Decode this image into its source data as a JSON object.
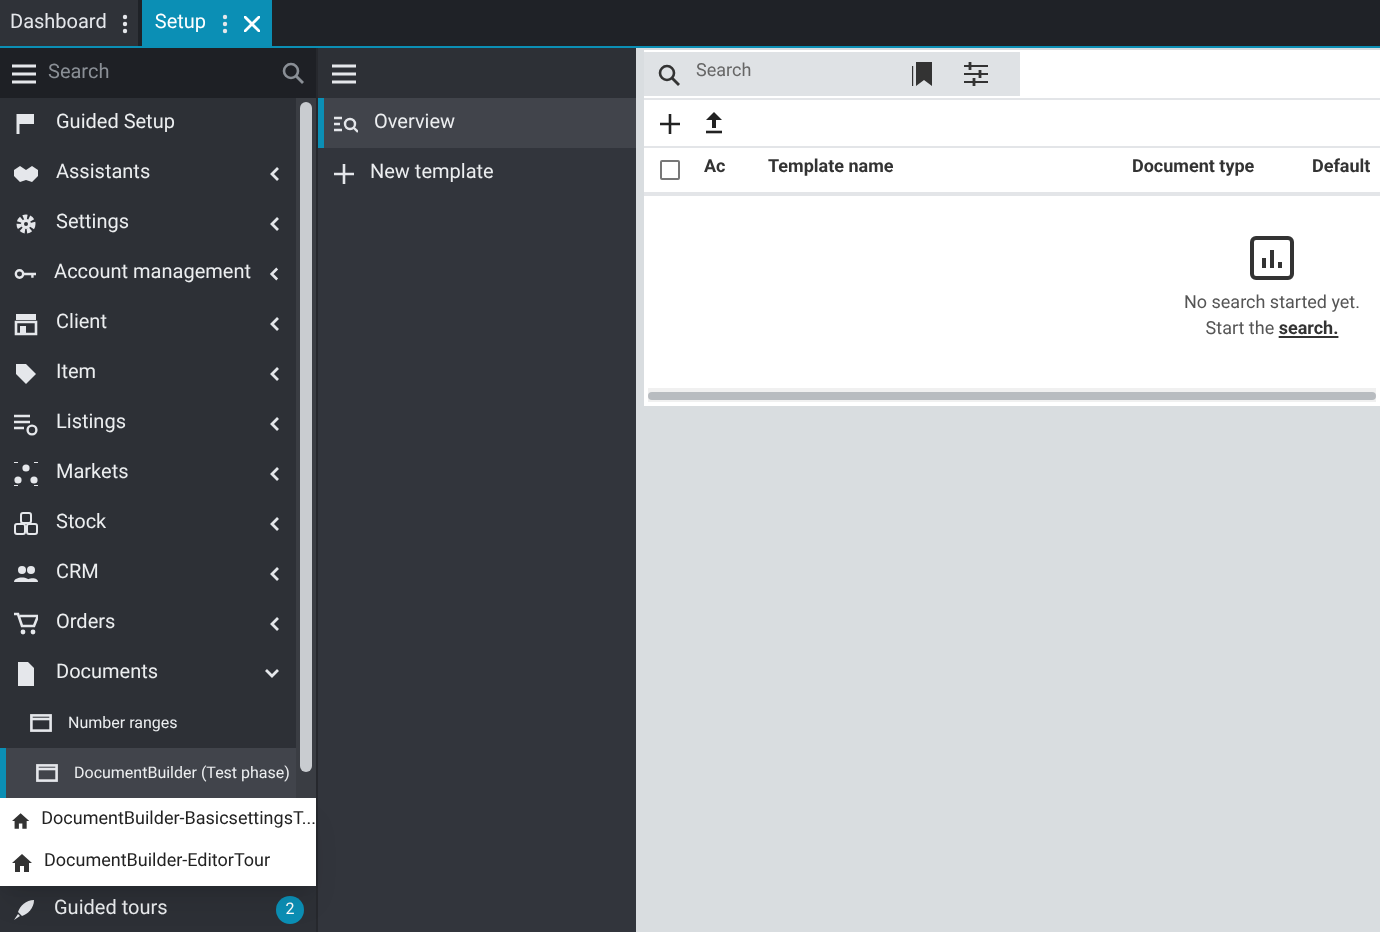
{
  "tabs": [
    {
      "label": "Dashboard",
      "selected": false,
      "closable": false
    },
    {
      "label": "Setup",
      "selected": true,
      "closable": true
    }
  ],
  "sidebar": {
    "search": {
      "placeholder": "Search"
    },
    "items": [
      {
        "label": "Guided Setup",
        "selected": false
      },
      {
        "label": "Assistants",
        "selected": false,
        "expanded": false
      },
      {
        "label": "Settings",
        "selected": false,
        "expanded": false
      },
      {
        "label": "Account management",
        "selected": false,
        "expanded": false
      },
      {
        "label": "Client",
        "selected": false,
        "expanded": false
      },
      {
        "label": "Item",
        "selected": false,
        "expanded": false
      },
      {
        "label": "Listings",
        "selected": false,
        "expanded": false
      },
      {
        "label": "Markets",
        "selected": false,
        "expanded": false
      },
      {
        "label": "Stock",
        "selected": false,
        "expanded": false
      },
      {
        "label": "CRM",
        "selected": false,
        "expanded": false
      },
      {
        "label": "Orders",
        "selected": false,
        "expanded": false
      },
      {
        "label": "Documents",
        "selected": false,
        "expanded": true,
        "children": [
          {
            "label": "Number ranges",
            "selected": false
          },
          {
            "label": "DocumentBuilder (Test phase)",
            "selected": true
          }
        ]
      }
    ],
    "popup": [
      {
        "label": "DocumentBuilder-BasicsettingsT..."
      },
      {
        "label": "DocumentBuilder-EditorTour"
      }
    ],
    "footer": {
      "label": "Guided tours",
      "badge": "2"
    }
  },
  "subnav": {
    "items": [
      {
        "label": "Overview",
        "selected": true,
        "kind": "overview"
      },
      {
        "label": "New template",
        "selected": false,
        "kind": "add"
      }
    ]
  },
  "main": {
    "search": {
      "placeholder": "Search"
    },
    "table": {
      "select_all": {
        "checked": false
      },
      "columns": [
        "Ac",
        "Template name",
        "Document type",
        "Default"
      ]
    },
    "empty": {
      "message": "No search started yet.",
      "prompt": "Start the",
      "link": "search."
    }
  }
}
